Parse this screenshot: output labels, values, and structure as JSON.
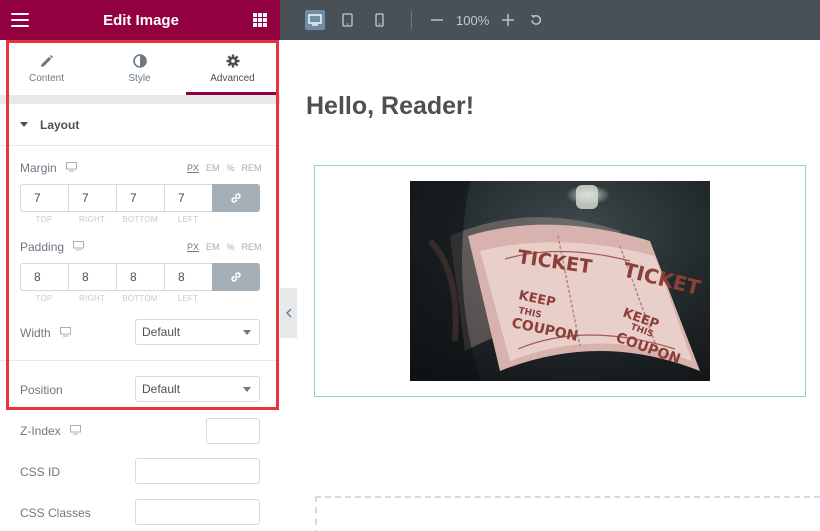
{
  "sidebar": {
    "title": "Edit Image",
    "tabs": [
      {
        "label": "Content",
        "icon": "pencil-icon"
      },
      {
        "label": "Style",
        "icon": "half-circle-icon"
      },
      {
        "label": "Advanced",
        "icon": "gear-icon",
        "active": true
      }
    ],
    "section": {
      "title": "Layout"
    },
    "margin": {
      "label": "Margin",
      "units": [
        "PX",
        "EM",
        "%",
        "REM"
      ],
      "active_unit": "PX",
      "values": [
        "7",
        "7",
        "7",
        "7"
      ],
      "sides": [
        "TOP",
        "RIGHT",
        "BOTTOM",
        "LEFT"
      ]
    },
    "padding": {
      "label": "Padding",
      "units": [
        "PX",
        "EM",
        "%",
        "REM"
      ],
      "active_unit": "PX",
      "values": [
        "8",
        "8",
        "8",
        "8"
      ],
      "sides": [
        "TOP",
        "RIGHT",
        "BOTTOM",
        "LEFT"
      ]
    },
    "width": {
      "label": "Width",
      "value": "Default"
    },
    "position": {
      "label": "Position",
      "value": "Default"
    },
    "z_index": {
      "label": "Z-Index",
      "value": ""
    },
    "css_id": {
      "label": "CSS ID",
      "value": ""
    },
    "css_classes": {
      "label": "CSS Classes",
      "value": ""
    }
  },
  "toolbar": {
    "zoom": "100%"
  },
  "canvas": {
    "heading": "Hello, Reader!",
    "image_alt": "ticket roll photo",
    "image_words": [
      "TICKET",
      "KEEP",
      "THIS",
      "COUPON",
      "TICKET",
      "KEEP",
      "THIS",
      "COUPON"
    ]
  },
  "colors": {
    "brand": "#93003f",
    "toolbar": "#495157",
    "highlight": "#e8323c",
    "widget_border": "#8fd4d8"
  }
}
